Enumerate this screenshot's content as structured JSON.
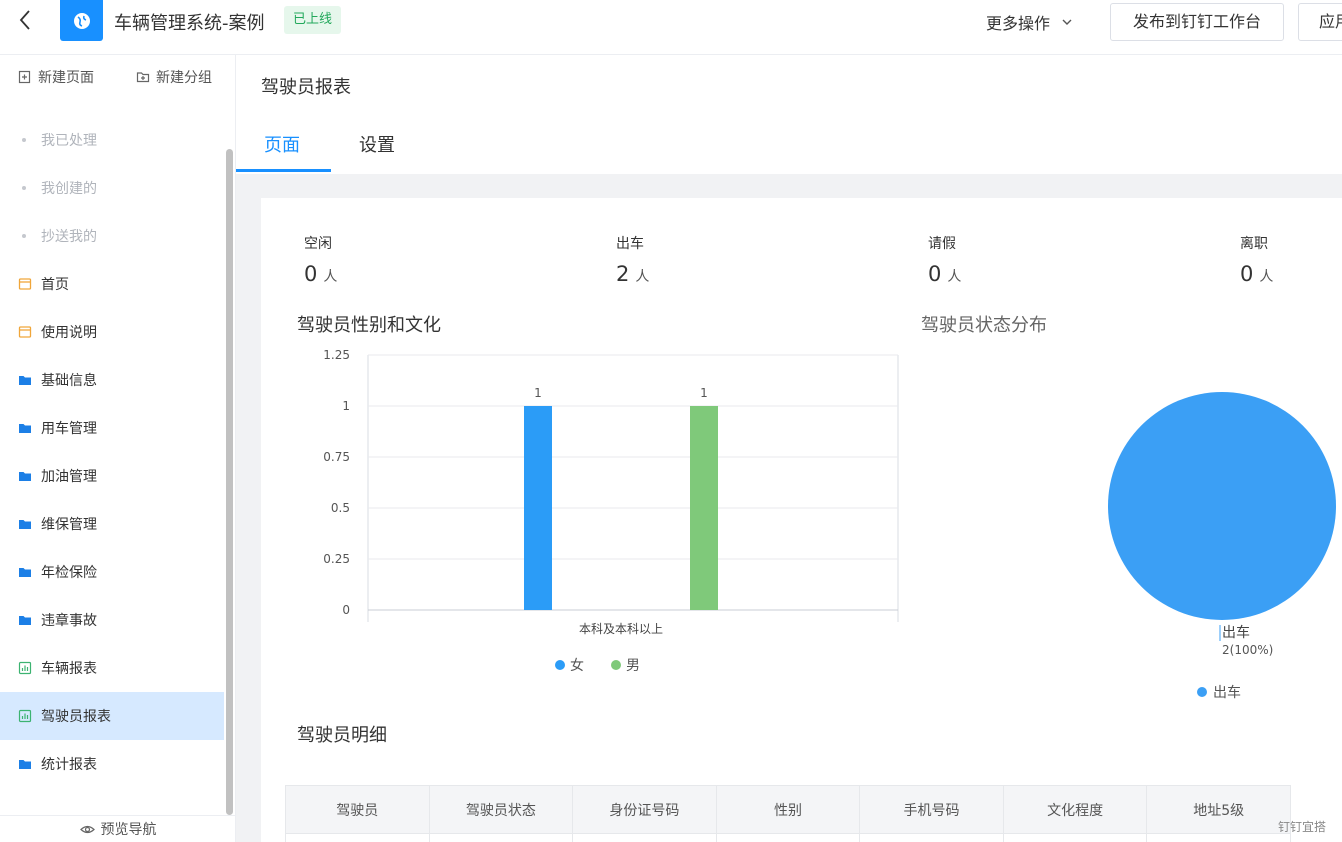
{
  "topbar": {
    "title": "车辆管理系统-案例",
    "status": "已上线",
    "more_ops": "更多操作",
    "publish": "发布到钉钉工作台",
    "app": "应用"
  },
  "sidebar": {
    "new_page": "新建页面",
    "new_group": "新建分组",
    "items": [
      {
        "label": "我已处理",
        "type": "dot"
      },
      {
        "label": "我创建的",
        "type": "dot"
      },
      {
        "label": "抄送我的",
        "type": "dot"
      },
      {
        "label": "首页",
        "type": "page"
      },
      {
        "label": "使用说明",
        "type": "page"
      },
      {
        "label": "基础信息",
        "type": "folder"
      },
      {
        "label": "用车管理",
        "type": "folder"
      },
      {
        "label": "加油管理",
        "type": "folder"
      },
      {
        "label": "维保管理",
        "type": "folder"
      },
      {
        "label": "年检保险",
        "type": "folder"
      },
      {
        "label": "违章事故",
        "type": "folder"
      },
      {
        "label": "车辆报表",
        "type": "report"
      },
      {
        "label": "驾驶员报表",
        "type": "report",
        "active": true
      },
      {
        "label": "统计报表",
        "type": "folder"
      }
    ],
    "preview_nav": "预览导航"
  },
  "page": {
    "title": "驾驶员报表",
    "tabs": [
      "页面",
      "设置"
    ]
  },
  "stats": [
    {
      "label": "空闲",
      "value": "0",
      "unit": "人"
    },
    {
      "label": "出车",
      "value": "2",
      "unit": "人"
    },
    {
      "label": "请假",
      "value": "0",
      "unit": "人"
    },
    {
      "label": "离职",
      "value": "0",
      "unit": "人"
    }
  ],
  "sections": {
    "bar_title": "驾驶员性别和文化",
    "pie_title": "驾驶员状态分布",
    "table_title": "驾驶员明细"
  },
  "chart_data": [
    {
      "type": "bar",
      "title": "驾驶员性别和文化",
      "categories": [
        "本科及本科以上"
      ],
      "series": [
        {
          "name": "女",
          "values": [
            1
          ],
          "color": "#2b9cf7"
        },
        {
          "name": "男",
          "values": [
            1
          ],
          "color": "#7fc97a"
        }
      ],
      "yticks": [
        "1.25",
        "1",
        "0.75",
        "0.5",
        "0.25",
        "0"
      ],
      "ylim": [
        0,
        1.25
      ],
      "data_labels": [
        "1",
        "1"
      ],
      "legend": "bottom",
      "grid": true
    },
    {
      "type": "pie",
      "title": "驾驶员状态分布",
      "slices": [
        {
          "name": "出车",
          "value": 2,
          "label": "2(100%)",
          "color": "#3b9ff5"
        }
      ],
      "legend": "bottom"
    }
  ],
  "table": {
    "headers": [
      "驾驶员",
      "驾驶员状态",
      "身份证号码",
      "性别",
      "手机号码",
      "文化程度",
      "地址5级"
    ]
  },
  "watermark": "钉钉宜搭",
  "colors": {
    "accent": "#1890ff",
    "active_nav": "#d6e9ff",
    "badge_bg": "#e6f7ec",
    "badge_text": "#22a85b"
  }
}
